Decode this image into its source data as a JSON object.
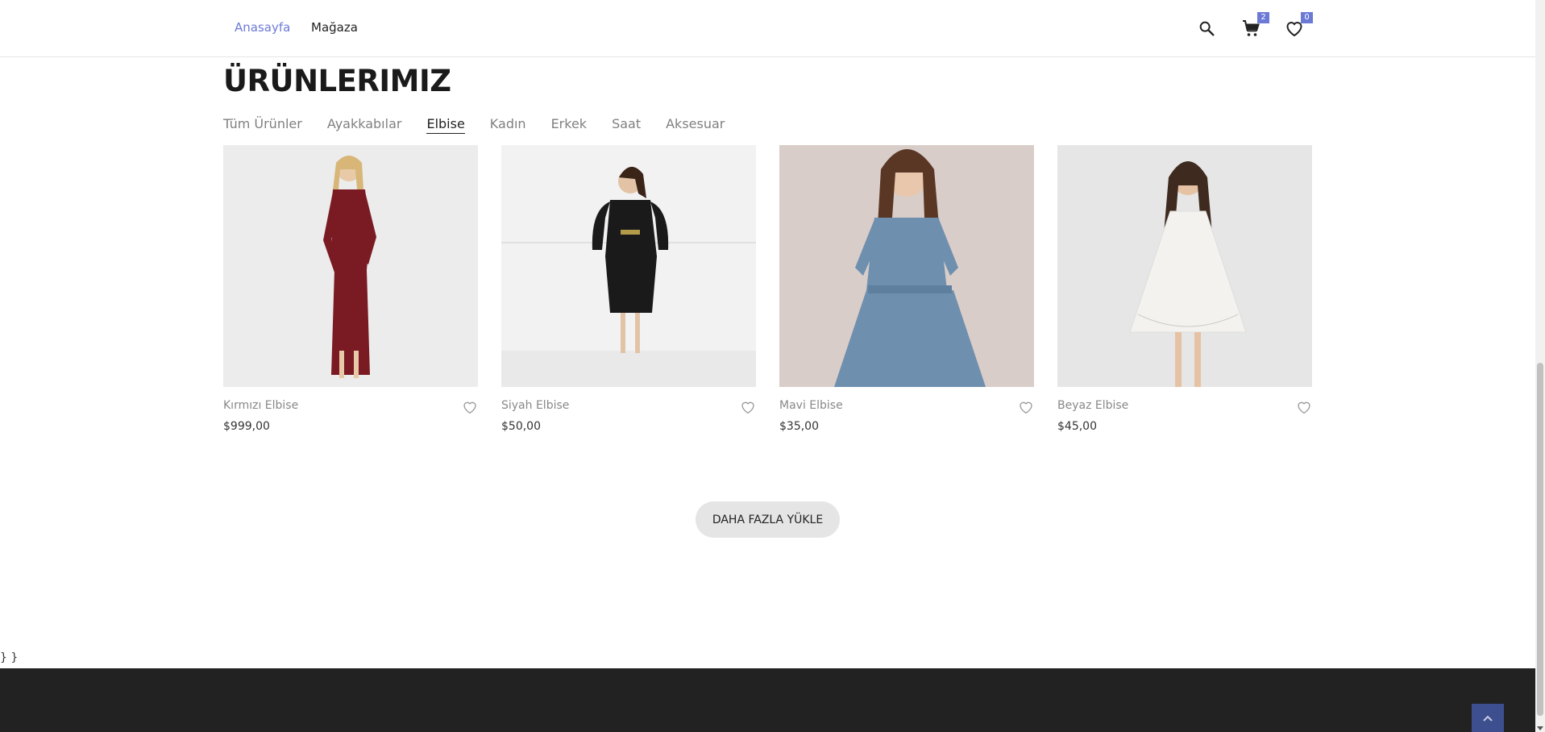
{
  "nav": {
    "home_label": "Anasayfa",
    "shop_label": "Mağaza",
    "cart_count": "2",
    "wishlist_count": "0",
    "accent_color": "#6c7ad6"
  },
  "section": {
    "title": "ÜRÜNLERIMIZ",
    "tabs": [
      {
        "label": "Tüm Ürünler"
      },
      {
        "label": "Ayakkabılar"
      },
      {
        "label": "Elbise",
        "active": true
      },
      {
        "label": "Kadın"
      },
      {
        "label": "Erkek"
      },
      {
        "label": "Saat"
      },
      {
        "label": "Aksesuar"
      }
    ]
  },
  "products": [
    {
      "name": "Kırmızı Elbise",
      "price": "$999,00",
      "dress_color": "#7a1a22"
    },
    {
      "name": "Siyah Elbise",
      "price": "$50,00",
      "dress_color": "#1a1a1a"
    },
    {
      "name": "Mavi Elbise",
      "price": "$35,00",
      "dress_color": "#6e8fae"
    },
    {
      "name": "Beyaz Elbise",
      "price": "$45,00",
      "dress_color": "#f4f2ee"
    }
  ],
  "load_more_label": "DAHA FAZLA YÜKLE",
  "stray_text": "} }",
  "footer": {
    "background": "#222222",
    "to_top_color": "#3d4f8f"
  }
}
